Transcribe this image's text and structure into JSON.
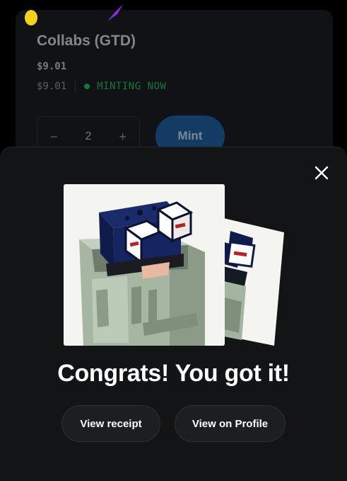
{
  "background": {
    "title": "Collabs (GTD)",
    "price_primary": "$9.01",
    "price_secondary": "$9.01",
    "status": "MINTING NOW",
    "stepper": {
      "minus": "−",
      "quantity": "2",
      "plus": "+"
    },
    "mint_label": "Mint"
  },
  "modal": {
    "close_icon": "close-icon",
    "headline": "Congrats! You got it!",
    "buttons": {
      "receipt": "View receipt",
      "profile": "View on Profile"
    }
  },
  "colors": {
    "sheet_bg": "#121416",
    "status_green": "#29b35a",
    "mint_blue": "#1f5b9a",
    "confetti_yellow": "#f4d21c",
    "confetti_purple": "#8a2be2"
  }
}
